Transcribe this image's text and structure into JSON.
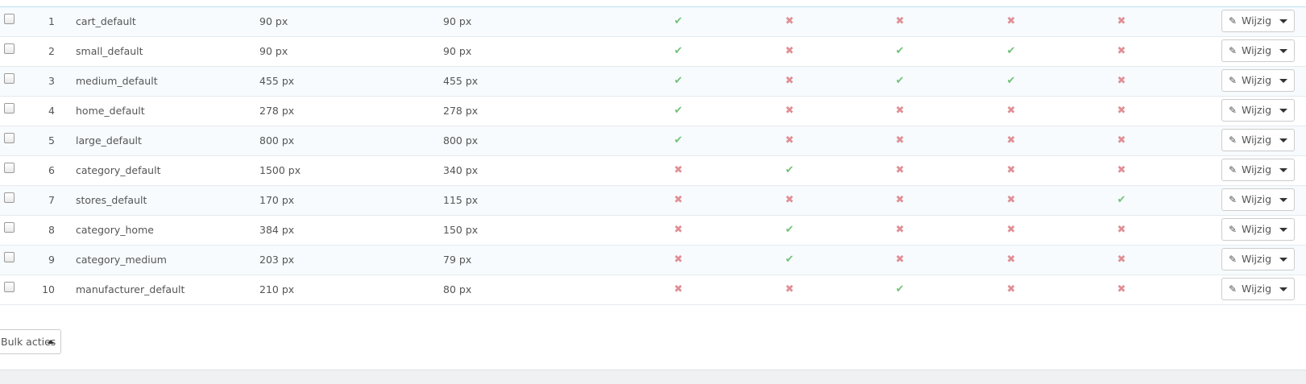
{
  "status_icons": {
    "yes": "check-icon",
    "no": "cross-icon"
  },
  "colors": {
    "yes": "#72c279",
    "no": "#e08f95",
    "row_alt": "#f7fbfe"
  },
  "rows": [
    {
      "id": "1",
      "name": "cart_default",
      "width": "90 px",
      "height": "90 px",
      "flags": [
        true,
        false,
        false,
        false,
        false
      ],
      "action": "Wijzig"
    },
    {
      "id": "2",
      "name": "small_default",
      "width": "90 px",
      "height": "90 px",
      "flags": [
        true,
        false,
        true,
        true,
        false
      ],
      "action": "Wijzig"
    },
    {
      "id": "3",
      "name": "medium_default",
      "width": "455 px",
      "height": "455 px",
      "flags": [
        true,
        false,
        true,
        true,
        false
      ],
      "action": "Wijzig"
    },
    {
      "id": "4",
      "name": "home_default",
      "width": "278 px",
      "height": "278 px",
      "flags": [
        true,
        false,
        false,
        false,
        false
      ],
      "action": "Wijzig"
    },
    {
      "id": "5",
      "name": "large_default",
      "width": "800 px",
      "height": "800 px",
      "flags": [
        true,
        false,
        false,
        false,
        false
      ],
      "action": "Wijzig"
    },
    {
      "id": "6",
      "name": "category_default",
      "width": "1500 px",
      "height": "340 px",
      "flags": [
        false,
        true,
        false,
        false,
        false
      ],
      "action": "Wijzig"
    },
    {
      "id": "7",
      "name": "stores_default",
      "width": "170 px",
      "height": "115 px",
      "flags": [
        false,
        false,
        false,
        false,
        true
      ],
      "action": "Wijzig"
    },
    {
      "id": "8",
      "name": "category_home",
      "width": "384 px",
      "height": "150 px",
      "flags": [
        false,
        true,
        false,
        false,
        false
      ],
      "action": "Wijzig"
    },
    {
      "id": "9",
      "name": "category_medium",
      "width": "203 px",
      "height": "79 px",
      "flags": [
        false,
        true,
        false,
        false,
        false
      ],
      "action": "Wijzig"
    },
    {
      "id": "10",
      "name": "manufacturer_default",
      "width": "210 px",
      "height": "80 px",
      "flags": [
        false,
        false,
        true,
        false,
        false
      ],
      "action": "Wijzig"
    }
  ],
  "bulk_actions": {
    "label": "Bulk acties"
  }
}
